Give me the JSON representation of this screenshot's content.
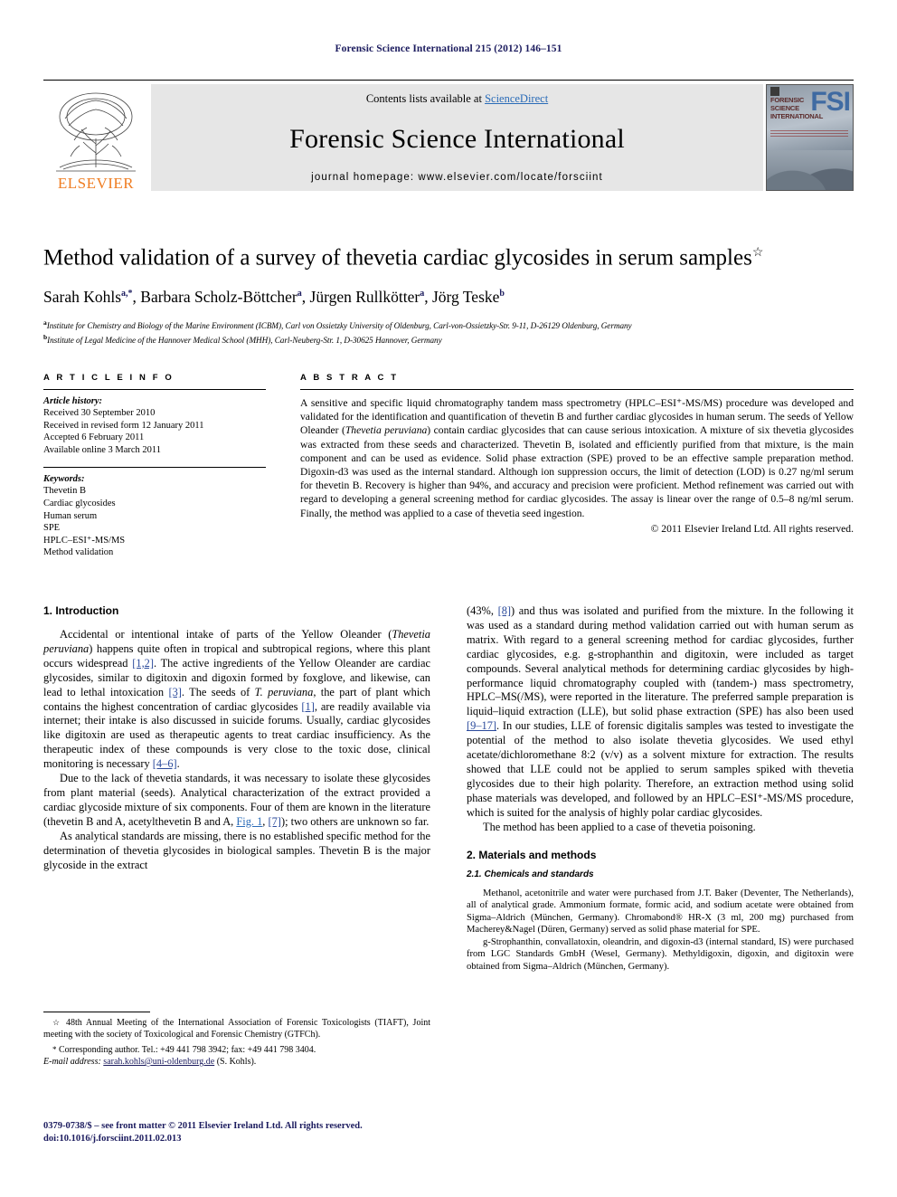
{
  "running_head": "Forensic Science International 215 (2012) 146–151",
  "masthead": {
    "contents_prefix": "Contents lists available at ",
    "sciencedirect": "ScienceDirect",
    "journal_title": "Forensic Science International",
    "homepage": "journal homepage: www.elsevier.com/locate/forsciint",
    "publisher": "ELSEVIER",
    "cover": {
      "brand": "FSI",
      "line1": "FORENSIC",
      "line2": "SCIENCE",
      "line3": "INTERNATIONAL"
    }
  },
  "title": "Method validation of a survey of thevetia cardiac glycosides in serum samples",
  "title_footnote_symbol": "☆",
  "authors": "Sarah Kohls, Barbara Scholz-Böttcher, Jürgen Rullkötter, Jörg Teske",
  "author_parts": [
    {
      "name": "Sarah Kohls",
      "sup": "a,*"
    },
    {
      "name": "Barbara Scholz-Böttcher",
      "sup": "a"
    },
    {
      "name": "Jürgen Rullkötter",
      "sup": "a"
    },
    {
      "name": "Jörg Teske",
      "sup": "b"
    }
  ],
  "affiliations": [
    {
      "sup": "a",
      "text": "Institute for Chemistry and Biology of the Marine Environment (ICBM), Carl von Ossietzky University of Oldenburg, Carl-von-Ossietzky-Str. 9-11, D-26129 Oldenburg, Germany"
    },
    {
      "sup": "b",
      "text": "Institute of Legal Medicine of the Hannover Medical School (MHH), Carl-Neuberg-Str. 1, D-30625 Hannover, Germany"
    }
  ],
  "article_info": {
    "label": "A R T I C L E   I N F O",
    "history_head": "Article history:",
    "history": [
      "Received 30 September 2010",
      "Received in revised form 12 January 2011",
      "Accepted 6 February 2011",
      "Available online 3 March 2011"
    ],
    "keywords_head": "Keywords:",
    "keywords": [
      "Thevetin B",
      "Cardiac glycosides",
      "Human serum",
      "SPE",
      "HPLC–ESI⁺-MS/MS",
      "Method validation"
    ]
  },
  "abstract": {
    "label": "A B S T R A C T",
    "text_1": "A sensitive and specific liquid chromatography tandem mass spectrometry (HPLC–ESI⁺-MS/MS) procedure was developed and validated for the identification and quantification of thevetin B and further cardiac glycosides in human serum. The seeds of Yellow Oleander (",
    "species": "Thevetia peruviana",
    "text_2": ") contain cardiac glycosides that can cause serious intoxication. A mixture of six thevetia glycosides was extracted from these seeds and characterized. Thevetin B, isolated and efficiently purified from that mixture, is the main component and can be used as evidence. Solid phase extraction (SPE) proved to be an effective sample preparation method. Digoxin-d3 was used as the internal standard. Although ion suppression occurs, the limit of detection (LOD) is 0.27 ng/ml serum for thevetin B. Recovery is higher than 94%, and accuracy and precision were proficient. Method refinement was carried out with regard to developing a general screening method for cardiac glycosides. The assay is linear over the range of 0.5–8 ng/ml serum. Finally, the method was applied to a case of thevetia seed ingestion.",
    "copyright": "© 2011 Elsevier Ireland Ltd. All rights reserved."
  },
  "sections": {
    "introduction_heading": "1. Introduction",
    "intro_p1_a": "Accidental or intentional intake of parts of the Yellow Oleander (",
    "intro_p1_species": "Thevetia peruviana",
    "intro_p1_b": ") happens quite often in tropical and subtropical regions, where this plant occurs widespread ",
    "intro_p1_ref1": "[1,2]",
    "intro_p1_c": ". The active ingredients of the Yellow Oleander are cardiac glycosides, similar to digitoxin and digoxin formed by foxglove, and likewise, can lead to lethal intoxication ",
    "intro_p1_ref2": "[3]",
    "intro_p1_d": ". The seeds of ",
    "intro_p1_species2": "T. peruviana",
    "intro_p1_e": ", the part of plant which contains the highest concentration of cardiac glycosides ",
    "intro_p1_ref3": "[1]",
    "intro_p1_f": ", are readily available via internet; their intake is also discussed in suicide forums. Usually, cardiac glycosides like digitoxin are used as therapeutic agents to treat cardiac insufficiency. As the therapeutic index of these compounds is very close to the toxic dose, clinical monitoring is necessary ",
    "intro_p1_ref4": "[4–6]",
    "intro_p1_g": ".",
    "intro_p2_a": "Due to the lack of thevetia standards, it was necessary to isolate these glycosides from plant material (seeds). Analytical characterization of the extract provided a cardiac glycoside mixture of six components. Four of them are known in the literature (thevetin B and A, acetylthevetin B and A, ",
    "intro_p2_fig": "Fig. 1",
    "intro_p2_b": ", ",
    "intro_p2_ref": "[7]",
    "intro_p2_c": "); two others are unknown so far.",
    "intro_p3": "As analytical standards are missing, there is no established specific method for the determination of thevetia glycosides in biological samples. Thevetin B is the major glycoside in the extract",
    "right_p1_a": "(43%, ",
    "right_p1_ref1": "[8]",
    "right_p1_b": ") and thus was isolated and purified from the mixture. In the following it was used as a standard during method validation carried out with human serum as matrix. With regard to a general screening method for cardiac glycosides, further cardiac glycosides, e.g. g-strophanthin and digitoxin, were included as target compounds. Several analytical methods for determining cardiac glycosides by high-performance liquid chromatography coupled with (tandem-) mass spectrometry, HPLC–MS(/MS), were reported in the literature. The preferred sample preparation is liquid–liquid extraction (LLE), but solid phase extraction (SPE) has also been used ",
    "right_p1_ref2": "[9–17]",
    "right_p1_c": ". In our studies, LLE of forensic digitalis samples was tested to investigate the potential of the method to also isolate thevetia glycosides. We used ethyl acetate/dichloromethane 8:2 (v/v) as a solvent mixture for extraction. The results showed that LLE could not be applied to serum samples spiked with thevetia glycosides due to their high polarity. Therefore, an extraction method using solid phase materials was developed, and followed by an HPLC–ESI⁺-MS/MS procedure, which is suited for the analysis of highly polar cardiac glycosides.",
    "right_p2": "The method has been applied to a case of thevetia poisoning.",
    "materials_heading": "2. Materials and methods",
    "chemicals_heading": "2.1. Chemicals and standards",
    "chem_p1": "Methanol, acetonitrile and water were purchased from J.T. Baker (Deventer, The Netherlands), all of analytical grade. Ammonium formate, formic acid, and sodium acetate were obtained from Sigma–Aldrich (München, Germany). Chromabond® HR-X (3 ml, 200 mg) purchased from Macherey&Nagel (Düren, Germany) served as solid phase material for SPE.",
    "chem_p2": "g-Strophanthin, convallatoxin, oleandrin, and digoxin-d3 (internal standard, IS) were purchased from LGC Standards GmbH (Wesel, Germany). Methyldigoxin, digoxin, and digitoxin were obtained from Sigma–Aldrich (München, Germany)."
  },
  "footnotes": {
    "fn1_symbol": "☆",
    "fn1": "48th Annual Meeting of the International Association of Forensic Toxicologists (TIAFT), Joint meeting with the society of Toxicological and Forensic Chemistry (GTFCh).",
    "fn2_symbol": "*",
    "fn2": "Corresponding author. Tel.: +49 441 798 3942; fax: +49 441 798 3404.",
    "email_label": "E-mail address:",
    "email": "sarah.kohls@uni-oldenburg.de",
    "email_suffix": "(S. Kohls)."
  },
  "colophon": {
    "line1": "0379-0738/$ – see front matter © 2011 Elsevier Ireland Ltd. All rights reserved.",
    "doi": "doi:10.1016/j.forsciint.2011.02.013"
  },
  "colors": {
    "running_head": "#1b1b5e",
    "link": "#2b6cb8",
    "reference": "#2b4a9b",
    "elsevier_orange": "#ef7d22",
    "masthead_bg": "#e6e6e6"
  }
}
